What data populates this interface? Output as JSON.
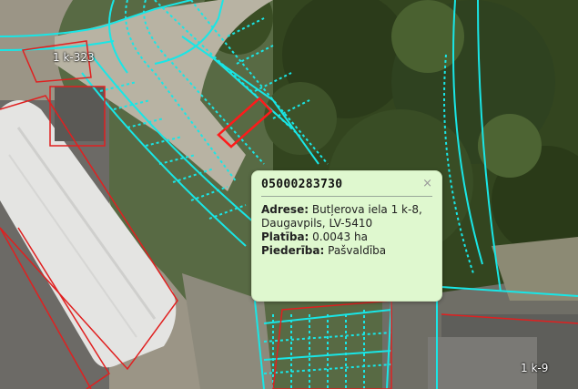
{
  "map": {
    "parcel_labels": [
      "1 k-323",
      "1 k-9"
    ],
    "colors": {
      "boundary": "#19e6e6",
      "selected": "#ff1a1a",
      "building": "#e02020"
    }
  },
  "popup": {
    "title": "05000283730",
    "close_glyph": "×",
    "address_label": "Adrese:",
    "address_value": "Butļerova iela 1 k-8, Daugavpils, LV-5410",
    "area_label": "Platība:",
    "area_value": "0.0043 ha",
    "ownership_label": "Piederība:",
    "ownership_value": "Pašvaldība"
  }
}
